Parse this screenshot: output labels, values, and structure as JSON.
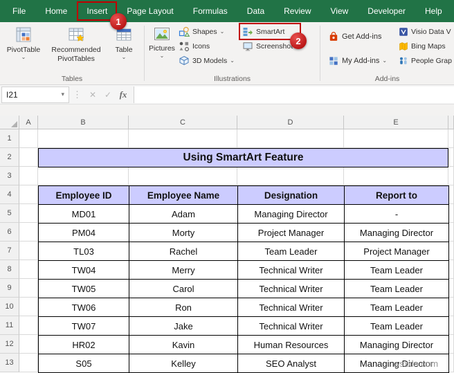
{
  "ribbon": {
    "tabs": [
      {
        "label": "File",
        "selected": false
      },
      {
        "label": "Home",
        "selected": false
      },
      {
        "label": "Insert",
        "selected": true
      },
      {
        "label": "Page Layout",
        "selected": false
      },
      {
        "label": "Formulas",
        "selected": false
      },
      {
        "label": "Data",
        "selected": false
      },
      {
        "label": "Review",
        "selected": false
      },
      {
        "label": "View",
        "selected": false
      },
      {
        "label": "Developer",
        "selected": false
      },
      {
        "label": "Help",
        "selected": false
      }
    ],
    "callouts": [
      {
        "number": "1"
      },
      {
        "number": "2"
      }
    ],
    "groups": [
      {
        "name": "Tables"
      },
      {
        "name": "Illustrations"
      },
      {
        "name": "Add-ins"
      }
    ],
    "buttons": {
      "pivottable": {
        "label": "PivotTable"
      },
      "recommended": {
        "line1": "Recommended",
        "line2": "PivotTables"
      },
      "table": {
        "label": "Table"
      },
      "pictures": {
        "label": "Pictures"
      },
      "shapes": {
        "label": "Shapes"
      },
      "icons": {
        "label": "Icons"
      },
      "models3d": {
        "label": "3D Models"
      },
      "smartart": {
        "label": "SmartArt"
      },
      "screenshot": {
        "label": "Screenshot"
      },
      "get_addins": {
        "label": "Get Add-ins"
      },
      "my_addins": {
        "label": "My Add-ins"
      },
      "visio": {
        "label": "Visio Data V"
      },
      "bing_maps": {
        "label": "Bing Maps"
      },
      "people_graph": {
        "label": "People Grap"
      }
    }
  },
  "formula_bar": {
    "name_box": "I21",
    "cancel": "✕",
    "enter": "✓",
    "fx": "fx"
  },
  "grid": {
    "columns": [
      "A",
      "B",
      "C",
      "D",
      "E"
    ],
    "rows": [
      "1",
      "2",
      "3",
      "4",
      "5",
      "6",
      "7",
      "8",
      "9",
      "10",
      "11",
      "12",
      "13"
    ]
  },
  "sheet": {
    "title": "Using SmartArt Feature"
  },
  "table": {
    "headers": [
      "Employee ID",
      "Employee Name",
      "Designation",
      "Report to"
    ],
    "rows": [
      [
        "MD01",
        "Adam",
        "Managing Director",
        "-"
      ],
      [
        "PM04",
        "Morty",
        "Project Manager",
        "Managing Director"
      ],
      [
        "TL03",
        "Rachel",
        "Team Leader",
        "Project Manager"
      ],
      [
        "TW04",
        "Merry",
        "Technical Writer",
        "Team Leader"
      ],
      [
        "TW05",
        "Carol",
        "Technical Writer",
        "Team Leader"
      ],
      [
        "TW06",
        "Ron",
        "Technical Writer",
        "Team Leader"
      ],
      [
        "TW07",
        "Jake",
        "Technical Writer",
        "Team Leader"
      ],
      [
        "HR02",
        "Kavin",
        "Human Resources",
        "Managing Director"
      ],
      [
        "S05",
        "Kelley",
        "SEO Analyst",
        "Managing Director"
      ]
    ]
  },
  "watermark": "wsxdn.com",
  "colors": {
    "ribbon_green": "#217346",
    "annotation_red": "#c00000",
    "table_header_fill": "#ccccff"
  }
}
